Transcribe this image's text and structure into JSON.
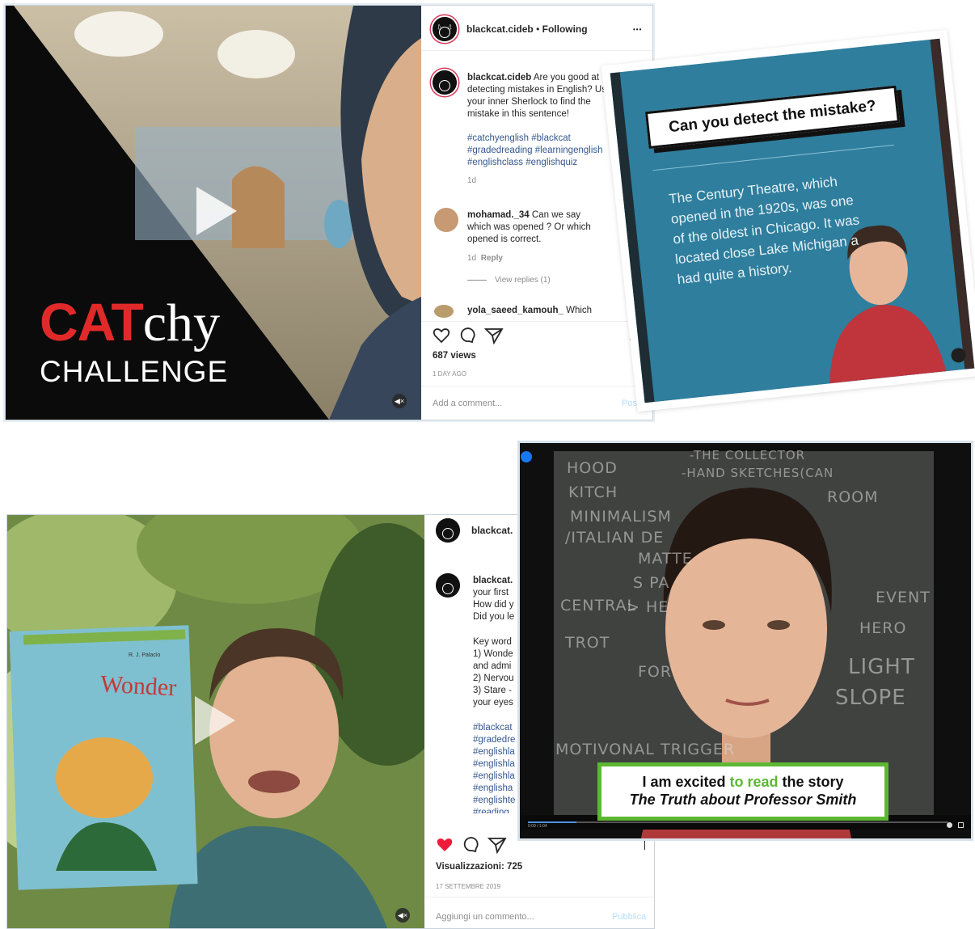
{
  "post1": {
    "username": "blackcat.cideb",
    "separator": "•",
    "follow_status": "Following",
    "more": "•••",
    "caption_user": "blackcat.cideb",
    "caption_lines": [
      "Are you good at",
      "detecting mistakes in English? Us",
      "your inner Sherlock to find the",
      "mistake in this sentence!"
    ],
    "hashtag_lines": [
      "#catchyenglish #blackcat",
      "#gradedreading #learningenglish",
      "#englishclass #englishquiz"
    ],
    "caption_age": "1d",
    "comment1": {
      "user": "mohamad._34",
      "text_lines": [
        "Can we say",
        "which was opened ? Or which",
        "opened is correct."
      ],
      "age": "1d",
      "reply": "Reply",
      "view_replies": "View replies (1)"
    },
    "comment2": {
      "user": "yola_saeed_kamouh_",
      "text": "Which"
    },
    "views": "687 views",
    "date": "1 DAY AGO",
    "comment_placeholder": "Add a comment...",
    "post_button": "Post",
    "logo_cat": "CAT",
    "logo_chy": "chy",
    "logo_challenge": "CHALLENGE"
  },
  "quiz": {
    "title": "Can you detect the mistake?",
    "lines": [
      "The Century Theatre, which",
      "opened in the 1920s, was one",
      "of the oldest in Chicago. It was",
      "located close Lake Michigan a",
      "had quite a history."
    ]
  },
  "post2": {
    "username": "blackcat.",
    "caption_user": "blackcat.",
    "caption_lines": [
      "your first ",
      "How did y",
      "Did you le"
    ],
    "key_lines": [
      "Key word",
      "1) Wonde",
      "and admi",
      "2) Nervou",
      "3) Stare -",
      "your eyes"
    ],
    "hashtag_lines": [
      "#blackcat",
      "#gradedre",
      "#englishla",
      "#englishla",
      "#englishla",
      "#englisha",
      "#englishte",
      "#reading"
    ],
    "views": "Visualizzazioni: 725",
    "date": "17 SETTEMBRE 2019",
    "comment_placeholder": "Aggiungi un commento...",
    "post_button": "Pubblica",
    "book_title": "Wonder",
    "book_author": "R. J. Palacio"
  },
  "video": {
    "caption_line1_a": "I am excited ",
    "caption_line1_b": "to read",
    "caption_line1_c": " the story",
    "caption_line2": "The Truth about Professor Smith",
    "chalk": [
      "HOOD",
      "KITCH",
      "MINIMALISM",
      "/ITALIAN DE",
      "-HAND SKETCHES(CAN",
      "-THE COLLECTOR",
      "CENTRAL",
      "TROT",
      "EVENT",
      "HERO",
      "LIGHT",
      "SLOPE",
      "MOTIVONAL TRIGGER",
      "MATTE",
      "S PA",
      "> HE",
      "FOR",
      "ROOM"
    ],
    "time": "0:09 / 1:04"
  },
  "colors": {
    "cat_red": "#e02a2a",
    "quiz_teal": "#2f7e9d",
    "caption_green": "#5cb832",
    "heart_red": "#ed1c3a"
  }
}
